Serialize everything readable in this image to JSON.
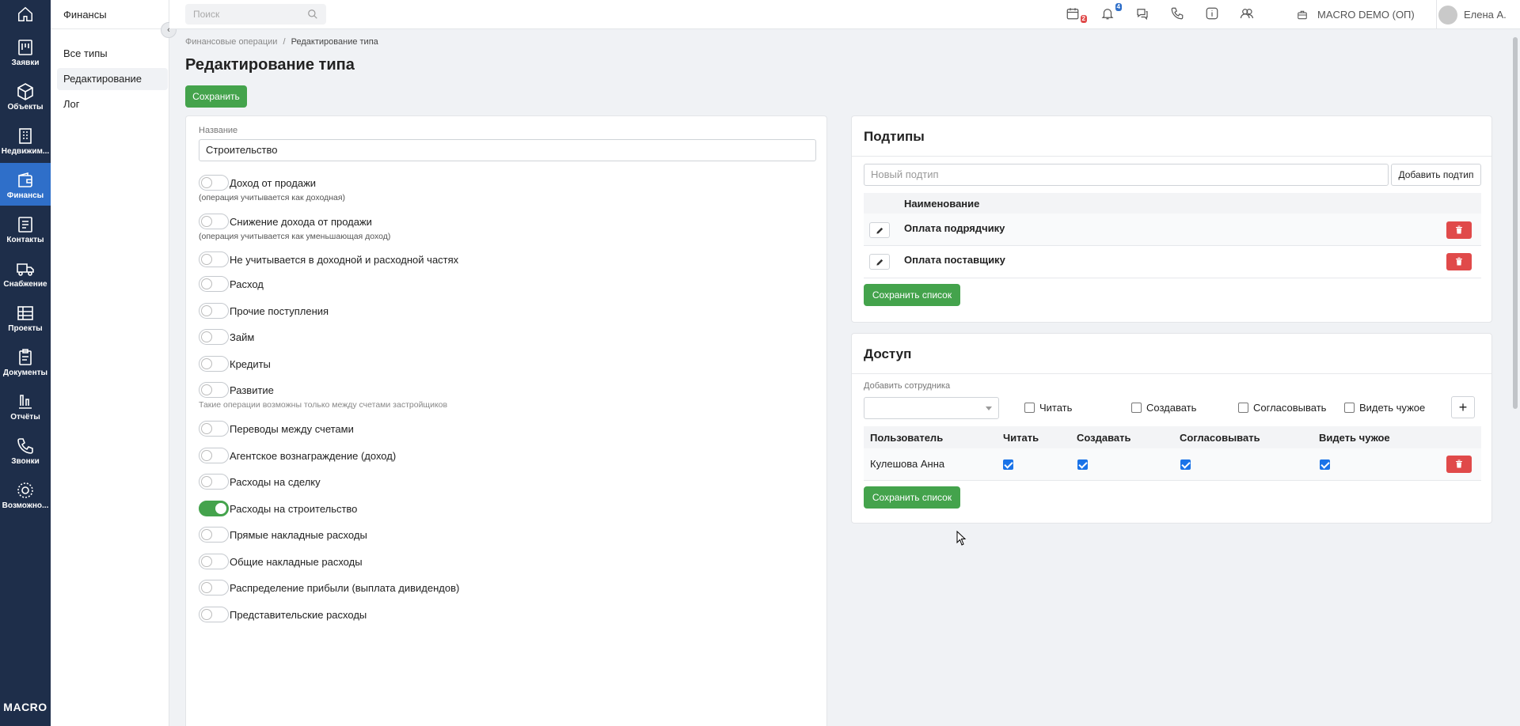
{
  "nav": {
    "items": [
      {
        "label": "Заявки",
        "icon": "requests-icon",
        "active": false
      },
      {
        "label": "Объекты",
        "icon": "cube-icon",
        "active": false
      },
      {
        "label": "Недвижим...",
        "icon": "building-icon",
        "active": false
      },
      {
        "label": "Финансы",
        "icon": "wallet-icon",
        "active": true
      },
      {
        "label": "Контакты",
        "icon": "contacts-icon",
        "active": false
      },
      {
        "label": "Снабжение",
        "icon": "truck-icon",
        "active": false
      },
      {
        "label": "Проекты",
        "icon": "projects-icon",
        "active": false
      },
      {
        "label": "Документы",
        "icon": "documents-icon",
        "active": false
      },
      {
        "label": "Отчёты",
        "icon": "chart-icon",
        "active": false
      },
      {
        "label": "Звонки",
        "icon": "phone-icon",
        "active": false
      },
      {
        "label": "Возможно...",
        "icon": "gear-icon",
        "active": false
      }
    ],
    "logo": "MACRO"
  },
  "subnav": {
    "title": "Финансы",
    "items": [
      {
        "label": "Все типы",
        "active": false
      },
      {
        "label": "Редактирование",
        "active": true
      },
      {
        "label": "Лог",
        "active": false
      }
    ]
  },
  "topbar": {
    "search_placeholder": "Поиск",
    "calendar_badge": "2",
    "notifications_badge": "4",
    "company": "MACRO DEMO (ОП)",
    "user": "Елена А."
  },
  "breadcrumb": {
    "parent": "Финансовые операции",
    "separator": "/",
    "current": "Редактирование типа"
  },
  "page_title": "Редактирование типа",
  "save_button": "Сохранить",
  "form": {
    "name_label": "Название",
    "name_value": "Строительство",
    "toggles": [
      {
        "label": "Доход от продажи",
        "hint": "(операция учитывается как доходная)",
        "on": false
      },
      {
        "label": "Снижение дохода от продажи",
        "hint": "(операция учитывается как уменьшающая доход)",
        "on": false
      },
      {
        "label": "Не учитывается в доходной и расходной частях",
        "hint": "",
        "on": false
      },
      {
        "label": "Расход",
        "hint": "",
        "on": false
      },
      {
        "label": "Прочие поступления",
        "hint": "",
        "on": false
      },
      {
        "label": "Займ",
        "hint": "",
        "on": false
      },
      {
        "label": "Кредиты",
        "hint": "",
        "on": false
      },
      {
        "label": "Развитие",
        "hint": "Такие операции возможны только между счетами застройщиков",
        "on": false
      },
      {
        "label": "Переводы между счетами",
        "hint": "",
        "on": false
      },
      {
        "label": "Агентское вознаграждение (доход)",
        "hint": "",
        "on": false
      },
      {
        "label": "Расходы на сделку",
        "hint": "",
        "on": false
      },
      {
        "label": "Расходы на строительство",
        "hint": "",
        "on": true
      },
      {
        "label": "Прямые накладные расходы",
        "hint": "",
        "on": false
      },
      {
        "label": "Общие накладные расходы",
        "hint": "",
        "on": false
      },
      {
        "label": "Распределение прибыли (выплата дивидендов)",
        "hint": "",
        "on": false
      },
      {
        "label": "Представительские расходы",
        "hint": "",
        "on": false
      }
    ]
  },
  "subtypes": {
    "title": "Подтипы",
    "new_placeholder": "Новый подтип",
    "add_button": "Добавить подтип",
    "column_name": "Наименование",
    "rows": [
      "Оплата подрядчику",
      "Оплата поставщику"
    ],
    "save_list": "Сохранить список"
  },
  "access": {
    "title": "Доступ",
    "add_employee_label": "Добавить сотрудника",
    "perm_labels": [
      "Читать",
      "Создавать",
      "Согласовывать",
      "Видеть чужое"
    ],
    "columns": [
      "Пользователь",
      "Читать",
      "Создавать",
      "Согласовывать",
      "Видеть чужое"
    ],
    "rows": [
      {
        "user": "Кулешова Анна",
        "read": true,
        "create": true,
        "approve": true,
        "see_others": true
      }
    ],
    "save_list": "Сохранить список"
  },
  "colors": {
    "nav_bg": "#1e2e4a",
    "nav_active": "#2f6fc9",
    "green": "#44a34c",
    "red": "#e04a4a"
  }
}
